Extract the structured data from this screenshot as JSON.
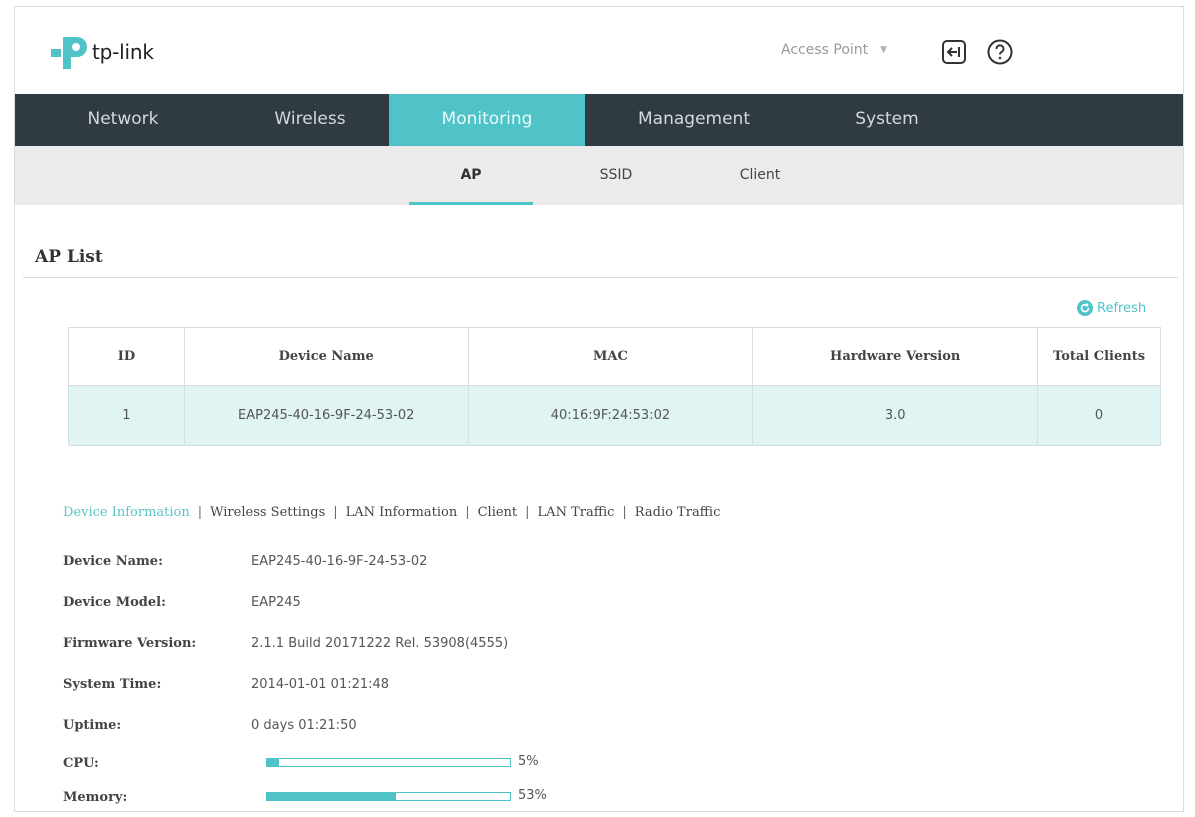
{
  "brand": {
    "name": "tp-link",
    "logo_color": "#4fc3c7"
  },
  "header": {
    "mode_value": "Access Point",
    "logout_icon": "logout-icon",
    "help_icon": "help-icon"
  },
  "top_nav": {
    "tabs": [
      {
        "label": "Network"
      },
      {
        "label": "Wireless"
      },
      {
        "label": "Monitoring",
        "active": true
      },
      {
        "label": "Management"
      },
      {
        "label": "System"
      }
    ]
  },
  "sub_nav": {
    "tabs": [
      {
        "label": "AP",
        "active": true
      },
      {
        "label": "SSID"
      },
      {
        "label": "Client"
      }
    ]
  },
  "ap_list": {
    "title": "AP List",
    "refresh_label": "Refresh",
    "columns": [
      "ID",
      "Device Name",
      "MAC",
      "Hardware Version",
      "Total Clients"
    ],
    "rows": [
      [
        "1",
        "EAP245-40-16-9F-24-53-02",
        "40:16:9F:24:53:02",
        "3.0",
        "0"
      ]
    ]
  },
  "detail_tabs": [
    {
      "label": "Device Information",
      "active": true
    },
    {
      "label": "Wireless Settings"
    },
    {
      "label": "LAN Information"
    },
    {
      "label": "Client"
    },
    {
      "label": "LAN Traffic"
    },
    {
      "label": "Radio Traffic"
    }
  ],
  "device_info": {
    "device_name": {
      "label": "Device Name:",
      "value": "EAP245-40-16-9F-24-53-02"
    },
    "device_model": {
      "label": "Device Model:",
      "value": "EAP245"
    },
    "firmware": {
      "label": "Firmware Version:",
      "value": "2.1.1 Build 20171222 Rel. 53908(4555)"
    },
    "system_time": {
      "label": "System Time:",
      "value": "2014-01-01 01:21:48"
    },
    "uptime": {
      "label": "Uptime:",
      "value": "0 days 01:21:50"
    },
    "cpu": {
      "label": "CPU:",
      "percent": 5,
      "display": "5%"
    },
    "memory": {
      "label": "Memory:",
      "percent": 53,
      "display": "53%"
    }
  },
  "colors": {
    "accent": "#4fc3c7",
    "nav_bg": "#2f3b40",
    "subnav_bg": "#ebebeb",
    "row_bg": "#dff4f3"
  }
}
